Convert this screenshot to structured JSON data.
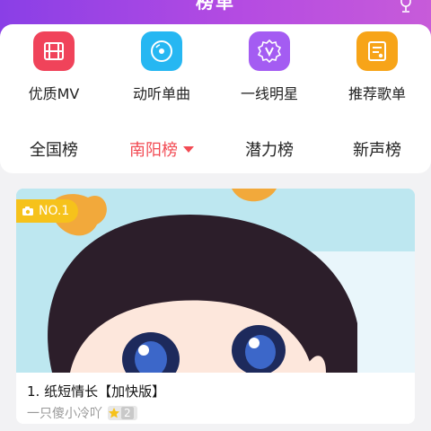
{
  "header": {
    "title": "榜单"
  },
  "categories": [
    {
      "label": "优质MV",
      "icon": "film-icon",
      "color": "#f0435a"
    },
    {
      "label": "动听单曲",
      "icon": "disc-icon",
      "color": "#26b7f2"
    },
    {
      "label": "一线明星",
      "icon": "v-badge-icon",
      "color": "#a45cf2"
    },
    {
      "label": "推荐歌单",
      "icon": "playlist-icon",
      "color": "#f7a418"
    }
  ],
  "tabs": [
    {
      "label": "全国榜",
      "active": false
    },
    {
      "label": "南阳榜",
      "active": true
    },
    {
      "label": "潜力榜",
      "active": false
    },
    {
      "label": "新声榜",
      "active": false
    }
  ],
  "song": {
    "badge": "NO.1",
    "title": "1. 纸短情长【加快版】",
    "artist": "一只傻小冷吖",
    "level": "2"
  },
  "colors": {
    "accent": "#f24b54",
    "header_start": "#8a3fe6",
    "header_end": "#c75bd9",
    "badge": "#f6c21b"
  }
}
